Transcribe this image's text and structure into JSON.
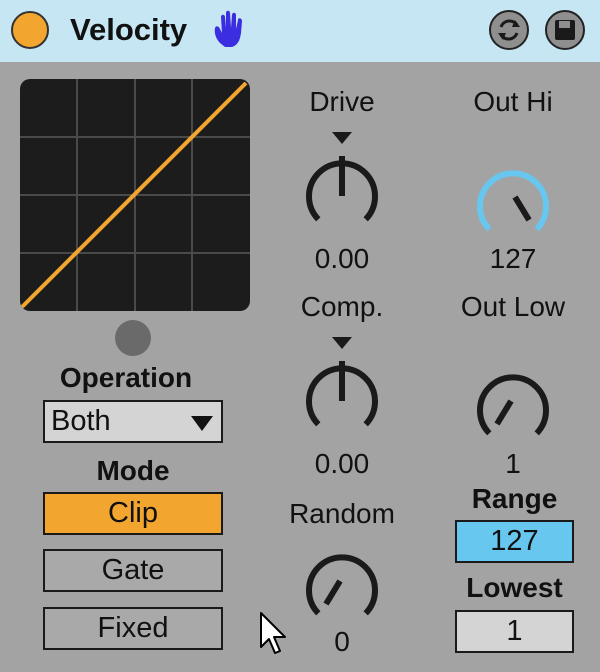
{
  "device": {
    "title": "Velocity",
    "power_color": "#f2a630",
    "hand_icon": "hand-icon",
    "header_buttons": [
      "hot-swap-icon",
      "save-icon"
    ]
  },
  "curve": {
    "color": "#f2a630",
    "background": "#1c1c1c",
    "grid": "4x4"
  },
  "operation": {
    "label": "Operation",
    "value": "Both"
  },
  "mode": {
    "label": "Mode",
    "buttons": [
      {
        "label": "Clip",
        "active": true
      },
      {
        "label": "Gate",
        "active": false
      },
      {
        "label": "Fixed",
        "active": false
      }
    ],
    "active_color": "#f2a630"
  },
  "knobs": {
    "drive": {
      "label": "Drive",
      "value": "0.00"
    },
    "comp": {
      "label": "Comp.",
      "value": "0.00"
    },
    "random": {
      "label": "Random",
      "value": "0"
    },
    "out_hi": {
      "label": "Out Hi",
      "value": "127",
      "accent": "#67c7ee"
    },
    "out_low": {
      "label": "Out Low",
      "value": "1"
    }
  },
  "range": {
    "label": "Range",
    "value": "127",
    "color": "#67c7ee"
  },
  "lowest": {
    "label": "Lowest",
    "value": "1"
  }
}
